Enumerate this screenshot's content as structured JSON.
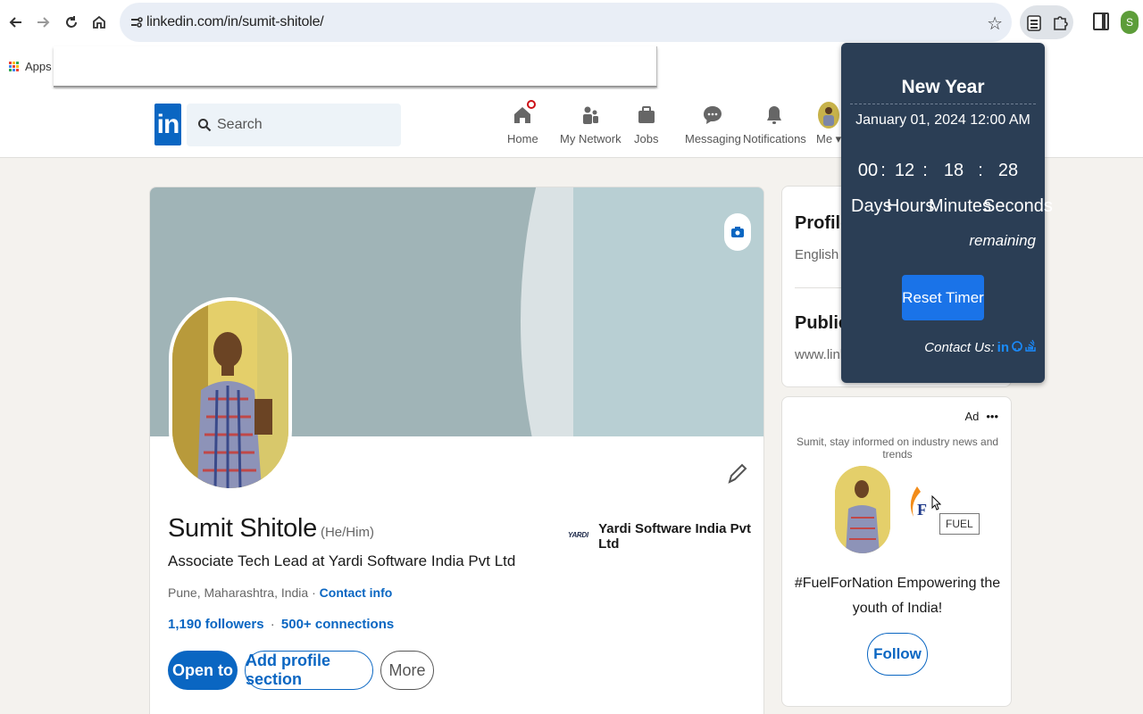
{
  "browser": {
    "url": "linkedin.com/in/sumit-shitole/",
    "bookmark_apps": "Apps",
    "profile_initial": "S"
  },
  "linkedin": {
    "search_placeholder": "Search",
    "nav": [
      {
        "label": "Home",
        "icon": "home-icon"
      },
      {
        "label": "My Network",
        "icon": "network-icon"
      },
      {
        "label": "Jobs",
        "icon": "briefcase-icon"
      },
      {
        "label": "Messaging",
        "icon": "chat-icon"
      },
      {
        "label": "Notifications",
        "icon": "bell-icon"
      },
      {
        "label": "Me",
        "icon": "avatar"
      }
    ]
  },
  "profile": {
    "name": "Sumit Shitole",
    "pronouns": "(He/Him)",
    "headline": "Associate Tech Lead at Yardi Software India Pvt Ltd",
    "location": "Pune, Maharashtra, India",
    "location_sep": " · ",
    "contact_info": "Contact info",
    "followers": "1,190 followers",
    "conn_sep": "·",
    "connections": "500+ connections",
    "company_logo_text": "YARDI",
    "company": "Yardi Software India Pvt Ltd",
    "buttons": {
      "open_to": "Open to",
      "add_section": "Add profile section",
      "more": "More"
    }
  },
  "sidebar": {
    "profile_language_title": "Profile l",
    "profile_language_value": "English",
    "public_profile_title": "Public p",
    "public_profile_value": "www.linke"
  },
  "ad": {
    "label": "Ad",
    "dots": "•••",
    "tagline": "Sumit, stay informed on industry news and trends",
    "tooltip": "FUEL",
    "body": "#FuelForNation Empowering the youth of India!",
    "follow": "Follow"
  },
  "popup": {
    "title": "New Year",
    "date": "January 01, 2024 12:00 AM",
    "days": "00",
    "hours": "12",
    "minutes": "18",
    "seconds": "28",
    "sep": ":",
    "days_label": "Days",
    "hours_label": "Hours",
    "minutes_label": "Minutes",
    "seconds_label": "Seconds",
    "remaining": "remaining",
    "reset": "Reset Timer",
    "contact": "Contact Us:"
  },
  "colors": {
    "linkedin_blue": "#0a66c2",
    "popup_bg": "#2b3e55",
    "reset_blue": "#1a73e8"
  }
}
